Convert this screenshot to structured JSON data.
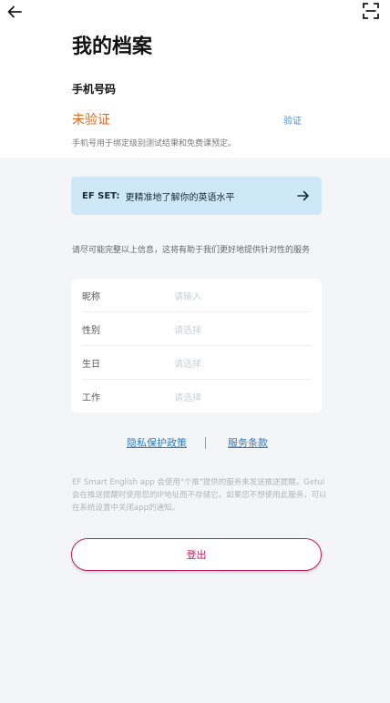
{
  "header": {
    "back_icon": "arrow-left-icon",
    "scan_icon": "scan-icon",
    "title": "我的档案"
  },
  "phone": {
    "section_label": "手机号码",
    "status": "未验证",
    "verify_label": "验证",
    "hint": "手机号用于绑定级别测试结果和免费课预定。",
    "status_color": "#e06a1c"
  },
  "efset_banner": {
    "prefix": "EF SET:",
    "text": "更精准地了解你的英语水平",
    "arrow_icon": "arrow-right-icon",
    "background": "#cfe8f7"
  },
  "info_text": "请尽可能完整以上信息，这将有助于我们更好地提供针对性的服务",
  "form": {
    "rows": [
      {
        "label": "昵称",
        "placeholder": "请输入"
      },
      {
        "label": "性别",
        "placeholder": "请选择"
      },
      {
        "label": "生日",
        "placeholder": "请选择"
      },
      {
        "label": "工作",
        "placeholder": "请选择"
      }
    ]
  },
  "links": {
    "privacy": "隐私保护政策",
    "terms": "服务条款"
  },
  "notice": "EF Smart English app 会使用\"个推\"提供的服务来发送推送提醒。Getui会在推送提醒时使用您的IP地址而不存储它。如果您不想使用此服务，可以在系统设置中关闭app的通知。",
  "logout": {
    "label": "登出",
    "accent": "#c2185b"
  }
}
